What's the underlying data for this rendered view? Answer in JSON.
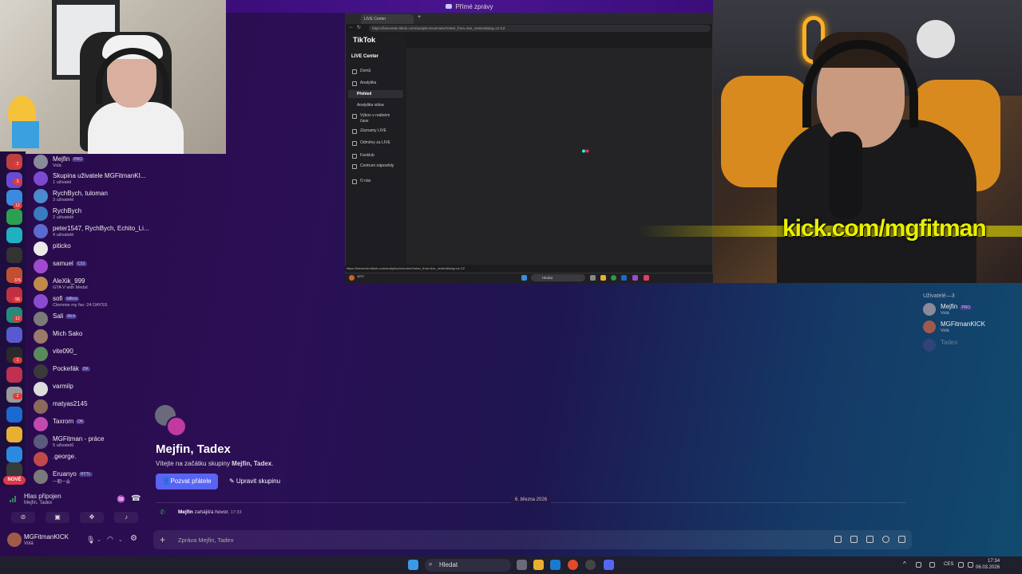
{
  "window": {
    "title": "Přímé zprávy"
  },
  "rail_badges": [
    "2",
    "3",
    "12",
    "376",
    "56",
    "12",
    "1",
    "2"
  ],
  "new_badge": "NOVÉ",
  "dms": [
    {
      "name": "Mejfin",
      "chip": "PRO",
      "sub": "Volá",
      "color": "#8a8a9a"
    },
    {
      "name": "Skupina uživatele MGFitmanKI...",
      "chip": "",
      "sub": "1 uživatel",
      "color": "#7a4ad0"
    },
    {
      "name": "RychBych, tuloman",
      "chip": "",
      "sub": "3 uživatelé",
      "color": "#4a8ad0"
    },
    {
      "name": "RychBych",
      "chip": "",
      "sub": "2 uživatelé",
      "color": "#3a7ac0"
    },
    {
      "name": "peter1547, RychBych, Echito_Li...",
      "chip": "",
      "sub": "4 uživatelé",
      "color": "#5a6ad0"
    },
    {
      "name": "piticko",
      "chip": "",
      "sub": "",
      "color": "#eaeaea"
    },
    {
      "name": "samuel",
      "chip": "CS2",
      "sub": "",
      "color": "#a04ad0"
    },
    {
      "name": "AleXik_999",
      "chip": "",
      "sub": "GTA V with Medal",
      "color": "#c08a4a"
    },
    {
      "name": "sofi",
      "chip": "killbox",
      "sub": "Clemmie my fav :24 DAYSS",
      "color": "#8a4ad0"
    },
    {
      "name": "Sali",
      "chip": "Rich",
      "sub": "",
      "color": "#7a7a7a"
    },
    {
      "name": "Mich Sako",
      "chip": "",
      "sub": "",
      "color": "#9a7a6a"
    },
    {
      "name": "vite090_",
      "chip": "",
      "sub": "",
      "color": "#5a8a5a"
    },
    {
      "name": "Pockefák",
      "chip": "DK",
      "sub": "",
      "color": "#3a3a3a"
    },
    {
      "name": "varmilp",
      "chip": "",
      "sub": "",
      "color": "#ddd"
    },
    {
      "name": "matyas2145",
      "chip": "",
      "sub": "",
      "color": "#8a6a5a"
    },
    {
      "name": "Taxrom",
      "chip": "DK",
      "sub": "",
      "color": "#c04ab0"
    },
    {
      "name": "MGFitman - práce",
      "chip": "",
      "sub": "5 uživatelů",
      "color": "#5a5a7a"
    },
    {
      "name": ".george.",
      "chip": "",
      "sub": "",
      "color": "#c04a4a"
    },
    {
      "name": "Eruanyo",
      "chip": "HYTL",
      "sub": "一期一会",
      "color": "#7a7a7a"
    }
  ],
  "voice": {
    "status": "Hlas připojen",
    "sub": "Mejfin, Tadex"
  },
  "user": {
    "name": "MGFitmanKICK",
    "status": "Volá"
  },
  "webcam": {
    "overlay": "kick.com/mgfitman"
  },
  "browser": {
    "tab": "LIVE Center",
    "url": "https://livecenter.tiktok.com/analytics/overview?enter_from=live_center&lang=cs-CZ",
    "status_url": "https://livecenter.tiktok.com/analytics/overview?enter_from=live_center&lang=cs-CZ",
    "logo": "TikTok",
    "section": "LIVE Center",
    "menu": [
      "Domů",
      "Analytika",
      "Přehled",
      "Analytika videa",
      "Výkon v reálném čase",
      "Záznamy LIVE",
      "Odměny za LIVE",
      "Fanklub",
      "Centrum nápovědy",
      "O nás"
    ],
    "search": "Hledat",
    "clock_time": "17:34",
    "clock_date": "06.03.2026",
    "weather": "10°C"
  },
  "members": {
    "header": "Uživatelé—3",
    "list": [
      {
        "name": "Mejfin",
        "chip": "PRO",
        "sub": "Volá",
        "color": "#8a8a9a"
      },
      {
        "name": "MGFitmanKICK",
        "chip": "",
        "sub": "Volá",
        "color": "#a05a4a"
      },
      {
        "name": "Tadex",
        "chip": "",
        "sub": "",
        "color": "#6a4a9a"
      }
    ]
  },
  "chat": {
    "title": "Mejfin, Tadex",
    "desc_prefix": "Vítejte na začátku skupiny ",
    "desc_name": "Mejfin, Tadex",
    "desc_suffix": ".",
    "invite": "Pozvat přátele",
    "edit": "Upravit skupinu",
    "date": "6. března 2026",
    "call_user": "Mejfin",
    "call_text": "zahájil/a hovor.",
    "call_time": "17:33",
    "placeholder": "Zpráva Mejfin, Tadex"
  },
  "taskbar": {
    "search": "Hledat",
    "lang": "CES",
    "time": "17:34",
    "date": "06.03.2026"
  }
}
